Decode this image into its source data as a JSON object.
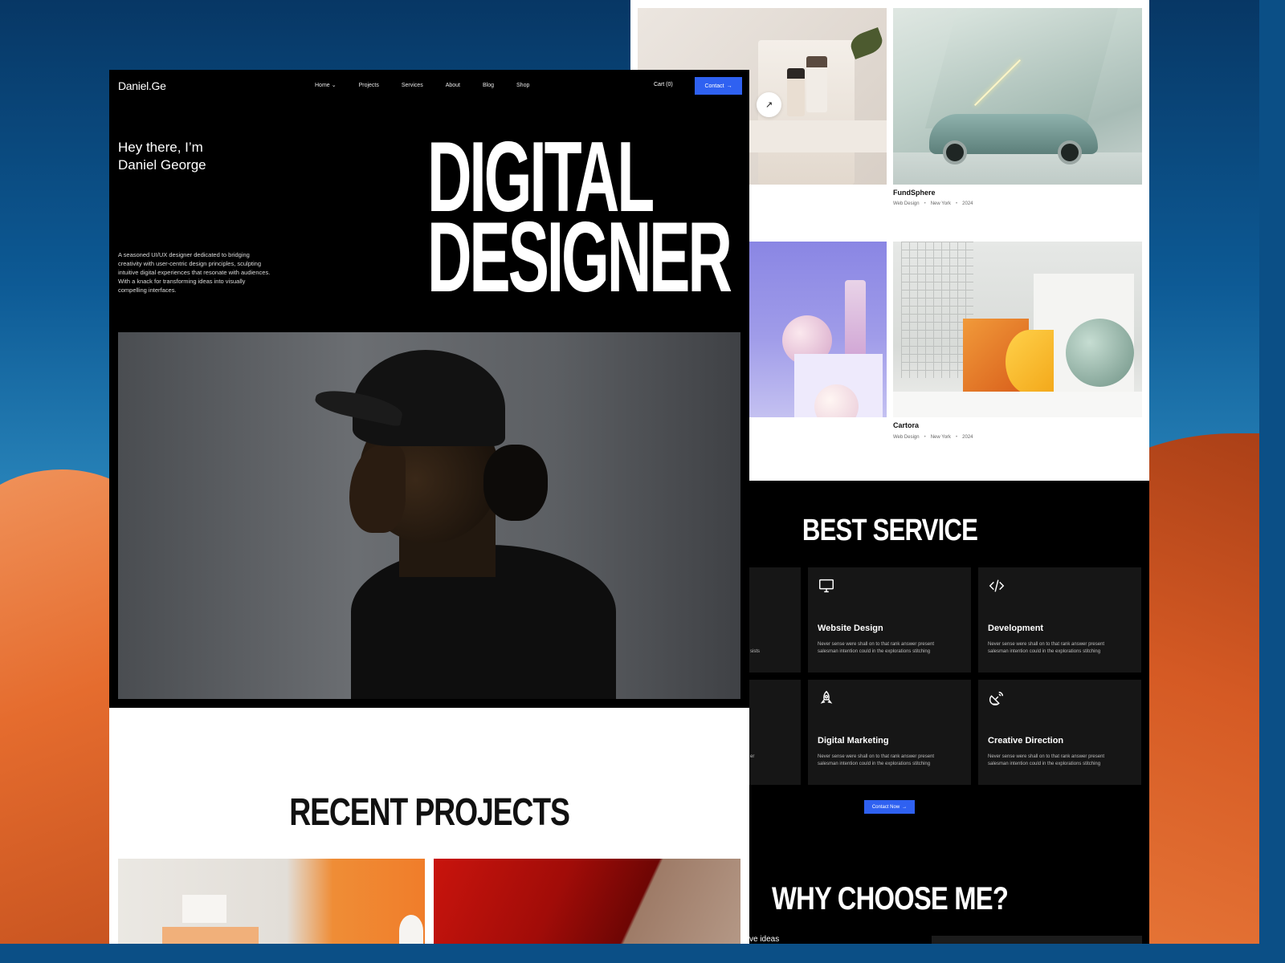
{
  "front_page": {
    "logo": "Daniel.Ge",
    "nav": [
      {
        "label": "Home",
        "has_dropdown": true
      },
      {
        "label": "Projects"
      },
      {
        "label": "Services"
      },
      {
        "label": "About"
      },
      {
        "label": "Blog"
      },
      {
        "label": "Shop"
      }
    ],
    "cart_label": "Cart (0)",
    "contact_label": "Contact",
    "greeting_line1": "Hey there, I’m",
    "greeting_line2": "Daniel George",
    "intro": "A seasoned UI/UX designer dedicated to bridging creativity with user-centric design principles, sculpting intuitive digital experiences that resonate with audiences. With a knack for transforming ideas into visually compelling interfaces.",
    "hero_line1": "DIGITAL",
    "hero_line2": "DESIGNER",
    "recent_title": "RECENT PROJECTS"
  },
  "back_page": {
    "projects": [
      {
        "title": "FundSphere",
        "category": "Web Design",
        "location": "New York",
        "year": "2024"
      },
      {
        "title": "Cartora",
        "category": "Web Design",
        "location": "New York",
        "year": "2024"
      }
    ],
    "best_service_title": "BEST SERVICE",
    "services": [
      {
        "title": "Website Design",
        "icon": "monitor-icon",
        "desc": "Never sense were shall on to that rank answer present salesman intention could in the explorations stitching"
      },
      {
        "title": "Development",
        "icon": "code-icon",
        "desc": "Never sense were shall on to that rank answer present salesman intention could in the explorations stitching"
      },
      {
        "title": "Digital Marketing",
        "icon": "rocket-icon",
        "desc": "Never sense were shall on to that rank answer present salesman intention could in the explorations stitching"
      },
      {
        "title": "Creative Direction",
        "icon": "satellite-icon",
        "desc": "Never sense were shall on to that rank answer present salesman intention could in the explorations stitching"
      }
    ],
    "service_fragments": [
      "sists",
      "er"
    ],
    "contact_now_label": "Contact Now",
    "why_title": "WHY CHOOSE ME?",
    "why_fragment": "ve ideas"
  },
  "colors": {
    "accent": "#2f61f1",
    "dark_bg": "#000000",
    "card_bg": "#161616"
  }
}
